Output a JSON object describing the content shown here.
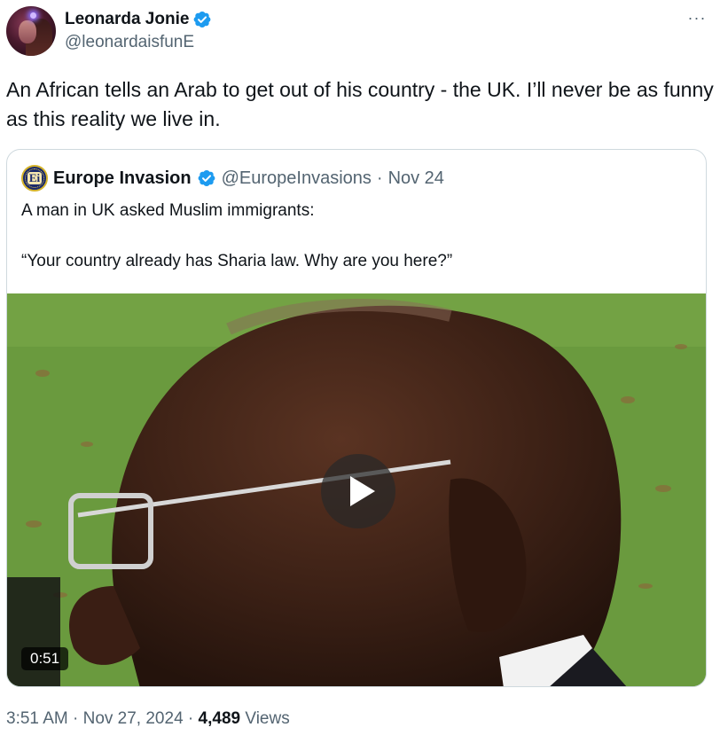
{
  "author": {
    "display_name": "Leonarda Jonie",
    "handle": "@leonardaisfunE",
    "verified_icon": "verified-badge-icon",
    "avatar_icon": "avatar-photo"
  },
  "more_label": "···",
  "tweet_text": "An African tells an Arab to get out of his country - the UK. I’ll never be as funny as this reality we live in.",
  "quote": {
    "avatar_text": "Ei",
    "display_name": "Europe Invasion",
    "handle": "@EuropeInvasions",
    "separator": "·",
    "date": "Nov 24",
    "line1": "A man in UK asked Muslim immigrants:",
    "line2": "“Your country already has Sharia law. Why are you here?”",
    "video": {
      "duration": "0:51",
      "play_icon": "play-icon"
    }
  },
  "footer": {
    "time": "3:51 AM",
    "sep1": "·",
    "date": "Nov 27, 2024",
    "sep2": "·",
    "views_count": "4,489",
    "views_label": "Views"
  },
  "colors": {
    "text_primary": "#0f1419",
    "text_secondary": "#536471",
    "verified_blue": "#1d9bf0",
    "border": "#cfd9de"
  }
}
